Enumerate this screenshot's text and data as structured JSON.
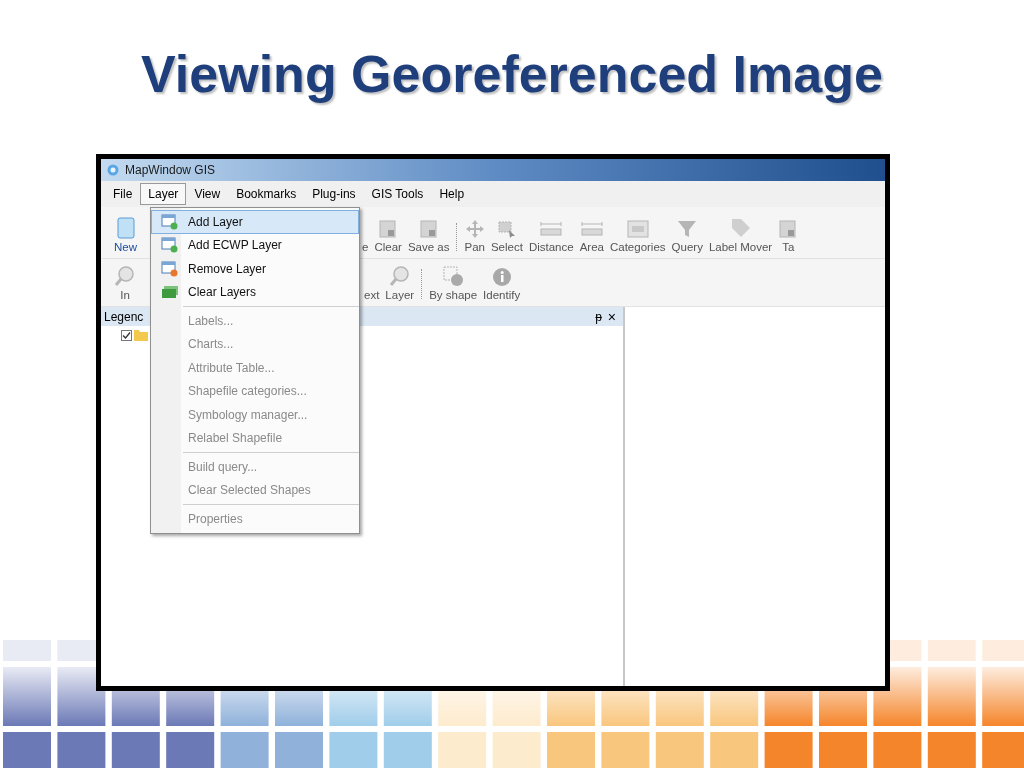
{
  "slide_title": "Viewing Georeferenced Image",
  "window": {
    "title": "MapWindow GIS"
  },
  "menu_bar": [
    {
      "label": "File",
      "selected": false
    },
    {
      "label": "Layer",
      "selected": true
    },
    {
      "label": "View",
      "selected": false
    },
    {
      "label": "Bookmarks",
      "selected": false
    },
    {
      "label": "Plug-ins",
      "selected": false
    },
    {
      "label": "GIS Tools",
      "selected": false
    },
    {
      "label": "Help",
      "selected": false
    }
  ],
  "toolbar_1": [
    "New",
    "e",
    "Clear",
    "Save as",
    "Pan",
    "Select",
    "Distance",
    "Area",
    "Categories",
    "Query",
    "Label Mover",
    "Ta"
  ],
  "toolbar_2": [
    "In",
    "ext",
    "Layer",
    "By shape",
    "Identify"
  ],
  "legend_panel": {
    "title": "Legenc",
    "pin": "ᵽ",
    "close": "×",
    "root_checked": true
  },
  "layer_menu": [
    [
      {
        "label": "Add Layer",
        "selected": true,
        "disabled": false
      },
      {
        "label": "Add ECWP Layer",
        "selected": false,
        "disabled": false
      },
      {
        "label": "Remove Layer",
        "selected": false,
        "disabled": false
      },
      {
        "label": "Clear Layers",
        "selected": false,
        "disabled": false
      }
    ],
    [
      {
        "label": "Labels...",
        "selected": false,
        "disabled": true
      },
      {
        "label": "Charts...",
        "selected": false,
        "disabled": true
      },
      {
        "label": "Attribute Table...",
        "selected": false,
        "disabled": true
      },
      {
        "label": "Shapefile categories...",
        "selected": false,
        "disabled": true
      },
      {
        "label": "Symbology manager...",
        "selected": false,
        "disabled": true
      },
      {
        "label": "Relabel Shapefile",
        "selected": false,
        "disabled": true
      }
    ],
    [
      {
        "label": "Build query...",
        "selected": false,
        "disabled": true
      },
      {
        "label": "Clear Selected Shapes",
        "selected": false,
        "disabled": true
      }
    ],
    [
      {
        "label": "Properties",
        "selected": false,
        "disabled": true
      }
    ]
  ]
}
